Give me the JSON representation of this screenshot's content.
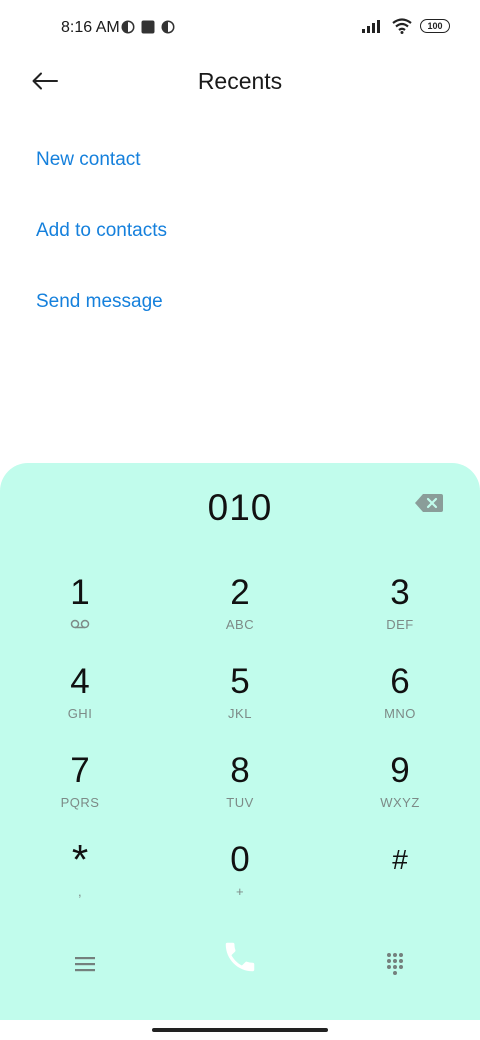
{
  "status_bar": {
    "time": "8:16 AM",
    "battery": "100"
  },
  "header": {
    "title": "Recents"
  },
  "actions": [
    {
      "label": "New contact"
    },
    {
      "label": "Add to contacts"
    },
    {
      "label": "Send message"
    }
  ],
  "dialpad": {
    "number": "010",
    "keys": [
      {
        "digit": "1",
        "sub": ""
      },
      {
        "digit": "2",
        "sub": "ABC"
      },
      {
        "digit": "3",
        "sub": "DEF"
      },
      {
        "digit": "4",
        "sub": "GHI"
      },
      {
        "digit": "5",
        "sub": "JKL"
      },
      {
        "digit": "6",
        "sub": "MNO"
      },
      {
        "digit": "7",
        "sub": "PQRS"
      },
      {
        "digit": "8",
        "sub": "TUV"
      },
      {
        "digit": "9",
        "sub": "WXYZ"
      },
      {
        "digit": "*",
        "sub": ","
      },
      {
        "digit": "0",
        "sub": "+"
      },
      {
        "digit": "#",
        "sub": ""
      }
    ]
  },
  "colors": {
    "accent": "#1580dc",
    "dialpad_bg": "#c1fcec",
    "call_icon": "#ffffff"
  },
  "icons": {
    "back": "arrow-left-icon",
    "backspace": "backspace-icon",
    "voicemail": "voicemail-icon",
    "menu": "menu-icon",
    "call": "phone-icon",
    "keypad": "dialpad-grid-icon"
  }
}
